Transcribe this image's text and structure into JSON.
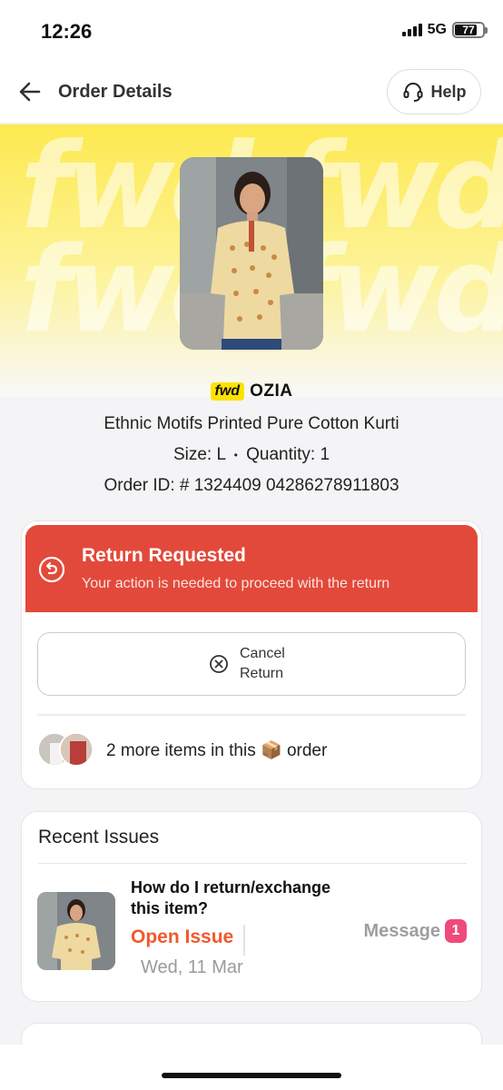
{
  "status_bar": {
    "time": "12:26",
    "network": "5G",
    "battery": "77"
  },
  "header": {
    "title": "Order Details",
    "help_label": "Help"
  },
  "product": {
    "brand_badge": "fwd",
    "brand_name": "OZIA",
    "name": "Ethnic Motifs Printed Pure Cotton Kurti",
    "size_label": "Size: L",
    "quantity_label": "Quantity: 1",
    "order_id_label": "Order ID: # 1324409 04286278911803"
  },
  "return_card": {
    "title": "Return Requested",
    "subtitle": "Your action is needed to proceed with the return",
    "cancel_line1": "Cancel",
    "cancel_line2": "Return",
    "more_items_prefix": "2 more items in this",
    "more_items_emoji": "📦",
    "more_items_suffix": "order"
  },
  "recent_issues": {
    "title": "Recent Issues",
    "items": [
      {
        "question": "How do I return/exchange this item?",
        "status": "Open Issue",
        "date": "Wed, 11 Mar",
        "message_label": "Message",
        "message_count": "1"
      }
    ]
  },
  "colors": {
    "accent_red": "#e2493a",
    "open_issue": "#f0592d",
    "badge_pink": "#f04a7a",
    "brand_yellow": "#fde200"
  }
}
